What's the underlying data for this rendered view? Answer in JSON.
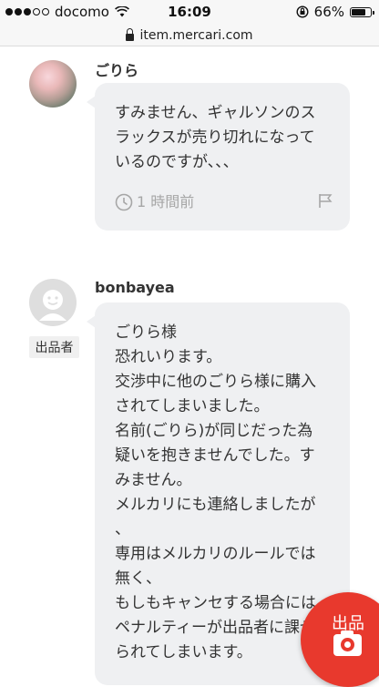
{
  "status_bar": {
    "carrier": "docomo",
    "time": "16:09",
    "battery": "66%",
    "signal_filled": 3,
    "signal_total": 5
  },
  "browser": {
    "url": "item.mercari.com"
  },
  "comments": [
    {
      "username": "ごりら",
      "lines": [
        "すみません、ギャルソンのス",
        "ラックスが売り切れになって",
        "いるのですが、、、"
      ],
      "time_ago": "1 時間前"
    },
    {
      "username": "bonbayea",
      "badge": "出品者",
      "lines": [
        "ごりら様",
        "恐れいります。",
        "交渉中に他のごりら様に購入",
        "されてしまいました。",
        "名前(ごりら)が同じだった為",
        "疑いを抱きませんでした。す",
        "みません。",
        "メルカリにも連絡しましたが",
        "、",
        "専用はメルカリのルールでは",
        "無く、",
        "もしもキャンセする場合には",
        "ペナルティーが出品者に課せ",
        "られてしまいます。"
      ]
    }
  ],
  "fab": {
    "label": "出品",
    "icon": "camera-icon"
  },
  "colors": {
    "accent": "#e8392d",
    "bubble": "#eff0f2",
    "muted": "#a6a6a6"
  }
}
